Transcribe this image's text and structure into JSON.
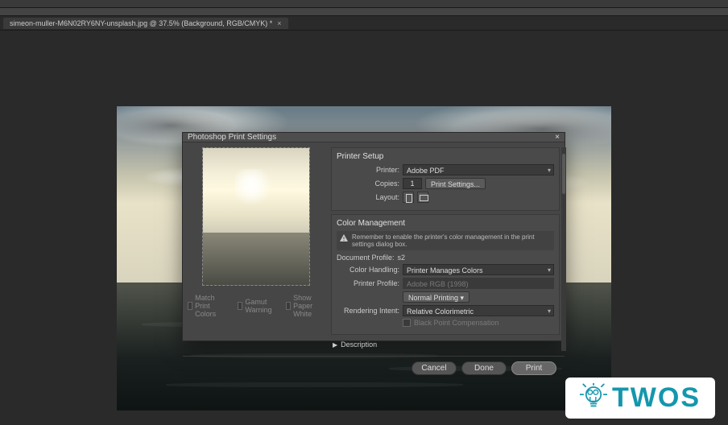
{
  "tab": {
    "title": "simeon-muller-M6N02RY6NY-unsplash.jpg @ 37.5% (Background, RGB/CMYK) *",
    "close_glyph": "×"
  },
  "dialog": {
    "title": "Photoshop Print Settings",
    "close_glyph": "×",
    "preview": {
      "match_colors_label": "Match Print Colors",
      "gamut_warning_label": "Gamut Warning",
      "paper_white_label": "Show Paper White"
    },
    "printer_setup": {
      "group_title": "Printer Setup",
      "printer_label": "Printer:",
      "printer_value": "Adobe PDF",
      "copies_label": "Copies:",
      "copies_value": "1",
      "print_settings_btn": "Print Settings...",
      "layout_label": "Layout:"
    },
    "color_mgmt": {
      "group_title": "Color Management",
      "note_text": "Remember to enable the printer's color management in the print settings dialog box.",
      "doc_profile_label": "Document Profile:",
      "doc_profile_value": "s2",
      "color_handling_label": "Color Handling:",
      "color_handling_value": "Printer Manages Colors",
      "printer_profile_label": "Printer Profile:",
      "printer_profile_value": "Adobe RGB (1998)",
      "normal_printing_btn": "Normal Printing",
      "rendering_intent_label": "Rendering Intent:",
      "rendering_intent_value": "Relative Colorimetric",
      "black_point_label": "Black Point Compensation"
    },
    "description_label": "Description",
    "buttons": {
      "cancel": "Cancel",
      "done": "Done",
      "print": "Print"
    }
  },
  "watermark": {
    "text": "TWOS"
  },
  "colors": {
    "dialog_bg": "#464646",
    "panel_bg": "#4a4a4a",
    "input_bg": "#3a3a3a",
    "text": "#cccccc",
    "brand": "#1497ad"
  }
}
